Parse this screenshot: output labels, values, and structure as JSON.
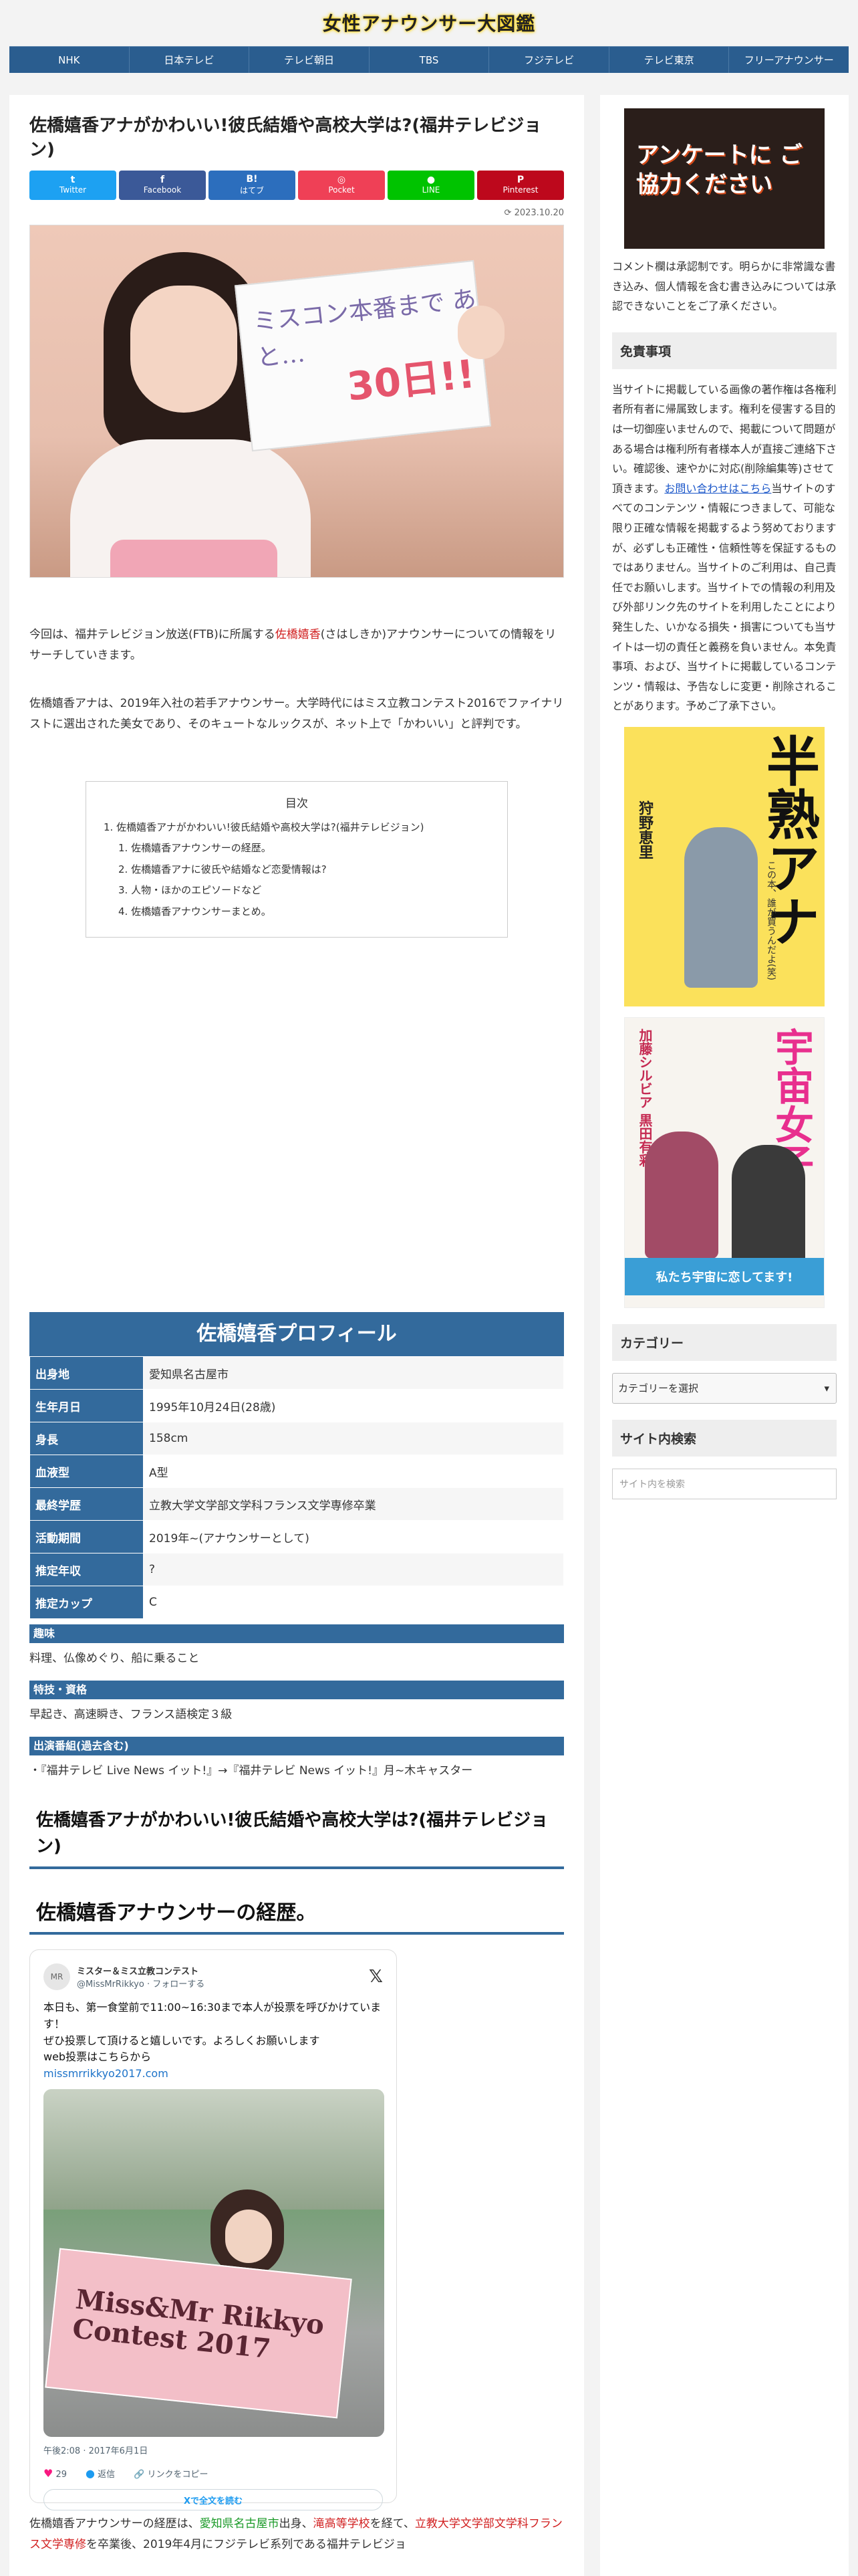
{
  "site": {
    "title": "女性アナウンサー大図鑑"
  },
  "nav": {
    "items": [
      "NHK",
      "日本テレビ",
      "テレビ朝日",
      "TBS",
      "フジテレビ",
      "テレビ東京",
      "フリーアナウンサー"
    ]
  },
  "article": {
    "title": "佐橋嬉香アナがかわいい!彼氏結婚や高校大学は?(福井テレビジョン)",
    "share": [
      {
        "label": "Twitter",
        "icon": "t"
      },
      {
        "label": "Facebook",
        "icon": "f"
      },
      {
        "label": "はてブ",
        "icon": "B!"
      },
      {
        "label": "Pocket",
        "icon": "◎"
      },
      {
        "label": "LINE",
        "icon": "●"
      },
      {
        "label": "Pinterest",
        "icon": "P"
      }
    ],
    "date": "2023.10.20",
    "eyecatch": {
      "sign_text": "ミスコン本番まで あと…",
      "sign_num": "30日!!"
    },
    "intro_1_a": "今回は、福井テレビジョン放送(FTB)に所属する",
    "intro_1_name": "佐橋嬉香",
    "intro_1_b": "(さはしきか)アナウンサーについての情報をリサーチしていきます。",
    "intro_2": "佐橋嬉香アナは、2019年入社の若手アナウンサー。大学時代にはミス立教コンテスト2016でファイナリストに選出された美女であり、そのキュートなルックスが、ネット上で「かわいい」と評判です。",
    "toc": {
      "title": "目次",
      "items": [
        "1. 佐橋嬉香アナがかわいい!彼氏結婚や高校大学は?(福井テレビジョン)",
        "1. 佐橋嬉香アナウンサーの経歴。",
        "2. 佐橋嬉香アナに彼氏や結婚など恋愛情報は?",
        "3. 人物・ほかのエピソードなど",
        "4. 佐橋嬉香アナウンサーまとめ。"
      ]
    },
    "profile": {
      "title": "佐橋嬉香プロフィール",
      "rows": [
        {
          "k": "出身地",
          "v": "愛知県名古屋市"
        },
        {
          "k": "生年月日",
          "v": "1995年10月24日(28歳)"
        },
        {
          "k": "身長",
          "v": "158cm"
        },
        {
          "k": "血液型",
          "v": "A型"
        },
        {
          "k": "最終学歴",
          "v": "立教大学文学部文学科フランス文学専修卒業"
        },
        {
          "k": "活動期間",
          "v": "2019年~(アナウンサーとして)"
        },
        {
          "k": "推定年収",
          "v": "?"
        },
        {
          "k": "推定カップ",
          "v": "C"
        }
      ],
      "hobby_label": "趣味",
      "hobby": "料理、仏像めぐり、船に乗ること",
      "skill_label": "特技・資格",
      "skill": "早起き、高速瞬き、フランス語検定３級",
      "shows_label": "出演番組(過去含む)",
      "shows": "『福井テレビ Live News イット!』→『福井テレビ News イット!』月~木キャスター"
    },
    "h2": "佐橋嬉香アナがかわいい!彼氏結婚や高校大学は?(福井テレビジョン)",
    "h3": "佐橋嬉香アナウンサーの経歴。",
    "tweet": {
      "avatar": "MR",
      "name": "ミスター＆ミス立教コンテスト",
      "handle": "@MissMrRikkyo · フォローする",
      "line1": "本日も、第一食堂前で11:00~16:30まで本人が投票を呼びかけています！",
      "line2": "ぜひ投票して頂けると嬉しいです。よろしくお願いします",
      "line3": "web投票はこちらから",
      "link": "missmrrikkyo2017.com",
      "banner": "Miss&Mr Rikkyo Contest 2017",
      "time": "午後2:08 · 2017年6月1日",
      "likes": "29",
      "reply": "返信",
      "copy": "リンクをコピー",
      "read_more": "Xで全文を読む"
    },
    "career_a": "佐橋嬉香アナウンサーの経歴は、",
    "career_b": "愛知県名古屋市",
    "career_c": "出身、",
    "career_d": "滝高等学校",
    "career_e": "を経て、",
    "career_f": "立教大学文学部文学科フランス文学専修",
    "career_g": "を卒業後、2019年4月にフジテレビ系列である福井テレビジョ"
  },
  "sidebar": {
    "ad_text": "アンケートに ご協力ください",
    "note": "コメント欄は承認制です。明らかに非常識な書き込み、個人情報を含む書き込みについては承認できないことをご了承ください。",
    "disclaimer_title": "免責事項",
    "disclaimer_a": "当サイトに掲載している画像の著作権は各権利者所有者に帰属致します。権利を侵害する目的は一切御座いませんので、掲載について問題がある場合は権利所有者様本人が直接ご連絡下さい。確認後、速やかに対応(削除編集等)させて頂きます。",
    "disclaimer_link": "お問い合わせはこちら",
    "disclaimer_b": "当サイトのすべてのコンテンツ・情報につきまして、可能な限り正確な情報を掲載するよう努めておりますが、必ずしも正確性・信頼性等を保証するものではありません。当サイトのご利用は、自己責任でお願いします。当サイトでの情報の利用及び外部リンク先のサイトを利用したことにより発生した、いかなる損失・損害についても当サイトは一切の責任と義務を負いません。本免責事項、および、当サイトに掲載しているコンテンツ・情報は、予告なしに変更・削除されることがあります。予めご了承下さい。",
    "book1": {
      "title": "半熟アナ",
      "author": "狩野恵里",
      "sub": "この本、誰が買うんだよ(笑)"
    },
    "book2": {
      "title": "宇宙女子",
      "authors": "加藤シルビア 黒田有彩",
      "band": "私たち宇宙に恋してます!"
    },
    "category_title": "カテゴリー",
    "category_select": "カテゴリーを選択",
    "search_title": "サイト内検索",
    "search_placeholder": "サイト内を検索"
  },
  "colors": {
    "nav": "#2a5d8f",
    "accent": "#336a9c",
    "red": "#d11f1f",
    "green": "#1a9a28"
  }
}
